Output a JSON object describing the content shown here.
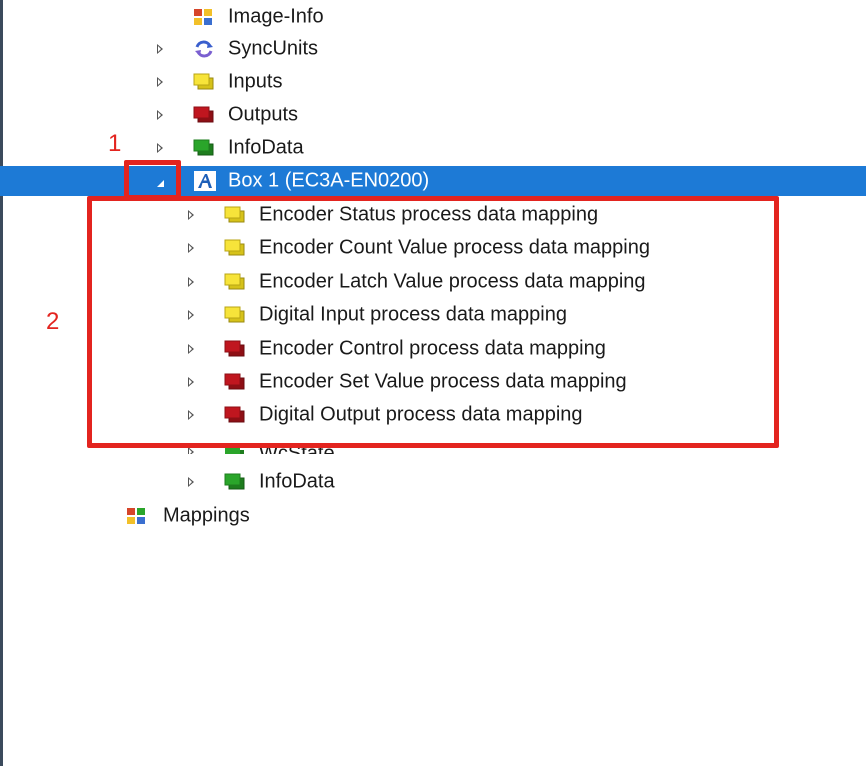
{
  "colors": {
    "selection": "#1d7ad6",
    "annotation_red": "#e3241f",
    "yellow": "#f7e43a",
    "red": "#c0161f",
    "green": "#2aa52a"
  },
  "tree": {
    "image_info": "Image-Info",
    "sync_units": "SyncUnits",
    "inputs": "Inputs",
    "outputs": "Outputs",
    "info_data": "InfoData",
    "box1": "Box 1 (EC3A-EN0200)",
    "children": [
      {
        "label": "Encoder Status process data mapping",
        "icon": "yellow-io-icon"
      },
      {
        "label": "Encoder Count Value process data mapping",
        "icon": "yellow-io-icon"
      },
      {
        "label": "Encoder Latch Value process data mapping",
        "icon": "yellow-io-icon"
      },
      {
        "label": "Digital Input process data mapping",
        "icon": "yellow-io-icon"
      },
      {
        "label": "Encoder Control process data mapping",
        "icon": "red-io-icon"
      },
      {
        "label": "Encoder Set Value process data mapping",
        "icon": "red-io-icon"
      },
      {
        "label": "Digital Output process data mapping",
        "icon": "red-io-icon"
      }
    ],
    "wc_state": "WcState",
    "box_info_data": "InfoData",
    "mappings": "Mappings"
  },
  "annotations": {
    "label_1": "1",
    "label_2": "2"
  }
}
